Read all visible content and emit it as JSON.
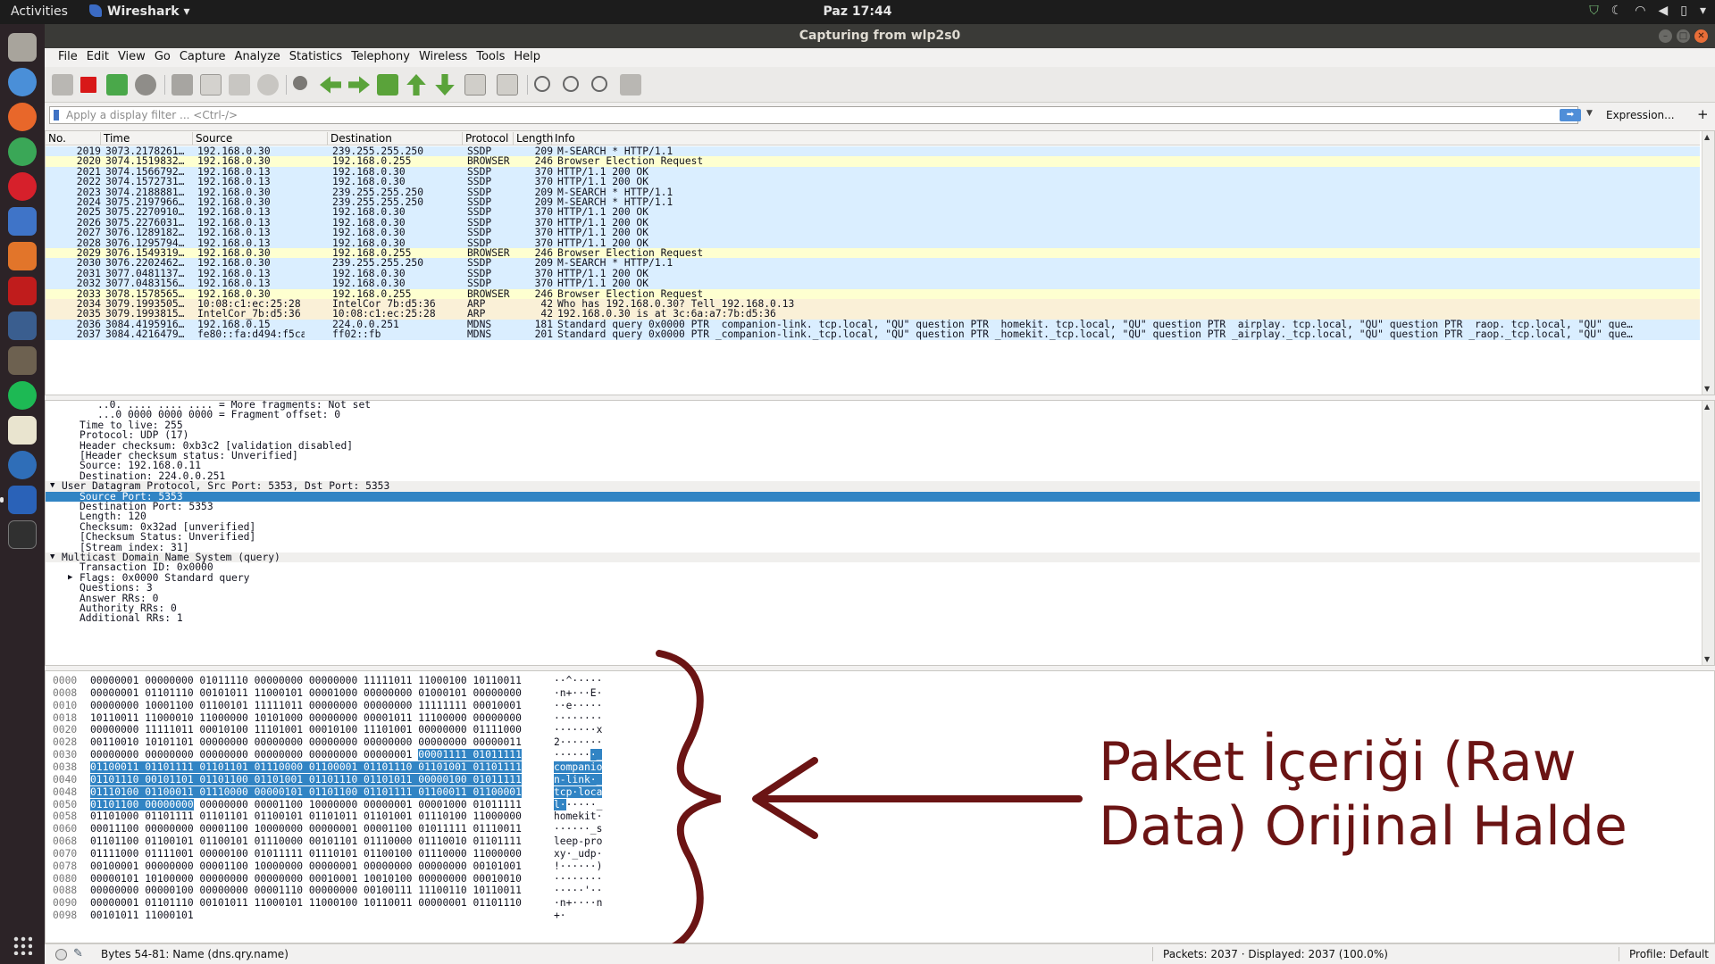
{
  "topbar": {
    "activities": "Activities",
    "app_name": "Wireshark",
    "clock": "Paz 17:44"
  },
  "window": {
    "title": "Capturing from wlp2s0"
  },
  "menu": [
    "File",
    "Edit",
    "View",
    "Go",
    "Capture",
    "Analyze",
    "Statistics",
    "Telephony",
    "Wireless",
    "Tools",
    "Help"
  ],
  "filter": {
    "placeholder": "Apply a display filter ... <Ctrl-/>",
    "expression_label": "Expression...",
    "add_label": "+"
  },
  "packet_list": {
    "columns": [
      "No.",
      "Time",
      "Source",
      "Destination",
      "Protocol",
      "Length",
      "Info"
    ],
    "colors": {
      "udp": "#daeeff",
      "smb": "#feffd0",
      "arp": "#faf0d7"
    },
    "rows": [
      {
        "no": "2019",
        "time": "3073.2178261…",
        "src": "192.168.0.30",
        "dst": "239.255.255.250",
        "proto": "SSDP",
        "len": "209",
        "info": "M-SEARCH * HTTP/1.1",
        "kind": "udp"
      },
      {
        "no": "2020",
        "time": "3074.1519832…",
        "src": "192.168.0.30",
        "dst": "192.168.0.255",
        "proto": "BROWSER",
        "len": "246",
        "info": "Browser Election Request",
        "kind": "smb"
      },
      {
        "no": "2021",
        "time": "3074.1566792…",
        "src": "192.168.0.13",
        "dst": "192.168.0.30",
        "proto": "SSDP",
        "len": "370",
        "info": "HTTP/1.1 200 OK",
        "kind": "udp"
      },
      {
        "no": "2022",
        "time": "3074.1572731…",
        "src": "192.168.0.13",
        "dst": "192.168.0.30",
        "proto": "SSDP",
        "len": "370",
        "info": "HTTP/1.1 200 OK",
        "kind": "udp"
      },
      {
        "no": "2023",
        "time": "3074.2188881…",
        "src": "192.168.0.30",
        "dst": "239.255.255.250",
        "proto": "SSDP",
        "len": "209",
        "info": "M-SEARCH * HTTP/1.1",
        "kind": "udp"
      },
      {
        "no": "2024",
        "time": "3075.2197966…",
        "src": "192.168.0.30",
        "dst": "239.255.255.250",
        "proto": "SSDP",
        "len": "209",
        "info": "M-SEARCH * HTTP/1.1",
        "kind": "udp"
      },
      {
        "no": "2025",
        "time": "3075.2270910…",
        "src": "192.168.0.13",
        "dst": "192.168.0.30",
        "proto": "SSDP",
        "len": "370",
        "info": "HTTP/1.1 200 OK",
        "kind": "udp"
      },
      {
        "no": "2026",
        "time": "3075.2276031…",
        "src": "192.168.0.13",
        "dst": "192.168.0.30",
        "proto": "SSDP",
        "len": "370",
        "info": "HTTP/1.1 200 OK",
        "kind": "udp"
      },
      {
        "no": "2027",
        "time": "3076.1289182…",
        "src": "192.168.0.13",
        "dst": "192.168.0.30",
        "proto": "SSDP",
        "len": "370",
        "info": "HTTP/1.1 200 OK",
        "kind": "udp"
      },
      {
        "no": "2028",
        "time": "3076.1295794…",
        "src": "192.168.0.13",
        "dst": "192.168.0.30",
        "proto": "SSDP",
        "len": "370",
        "info": "HTTP/1.1 200 OK",
        "kind": "udp"
      },
      {
        "no": "2029",
        "time": "3076.1549319…",
        "src": "192.168.0.30",
        "dst": "192.168.0.255",
        "proto": "BROWSER",
        "len": "246",
        "info": "Browser Election Request",
        "kind": "smb"
      },
      {
        "no": "2030",
        "time": "3076.2202462…",
        "src": "192.168.0.30",
        "dst": "239.255.255.250",
        "proto": "SSDP",
        "len": "209",
        "info": "M-SEARCH * HTTP/1.1",
        "kind": "udp"
      },
      {
        "no": "2031",
        "time": "3077.0481137…",
        "src": "192.168.0.13",
        "dst": "192.168.0.30",
        "proto": "SSDP",
        "len": "370",
        "info": "HTTP/1.1 200 OK",
        "kind": "udp"
      },
      {
        "no": "2032",
        "time": "3077.0483156…",
        "src": "192.168.0.13",
        "dst": "192.168.0.30",
        "proto": "SSDP",
        "len": "370",
        "info": "HTTP/1.1 200 OK",
        "kind": "udp"
      },
      {
        "no": "2033",
        "time": "3078.1578565…",
        "src": "192.168.0.30",
        "dst": "192.168.0.255",
        "proto": "BROWSER",
        "len": "246",
        "info": "Browser Election Request",
        "kind": "smb"
      },
      {
        "no": "2034",
        "time": "3079.1993505…",
        "src": "10:08:c1:ec:25:28",
        "dst": "IntelCor_7b:d5:36",
        "proto": "ARP",
        "len": "42",
        "info": "Who has 192.168.0.30? Tell 192.168.0.13",
        "kind": "arp"
      },
      {
        "no": "2035",
        "time": "3079.1993815…",
        "src": "IntelCor_7b:d5:36",
        "dst": "10:08:c1:ec:25:28",
        "proto": "ARP",
        "len": "42",
        "info": "192.168.0.30 is at 3c:6a:a7:7b:d5:36",
        "kind": "arp"
      },
      {
        "no": "2036",
        "time": "3084.4195916…",
        "src": "192.168.0.15",
        "dst": "224.0.0.251",
        "proto": "MDNS",
        "len": "181",
        "info": "Standard query 0x0000 PTR _companion-link._tcp.local, \"QU\" question PTR _homekit._tcp.local, \"QU\" question PTR _airplay._tcp.local, \"QU\" question PTR _raop._tcp.local, \"QU\" que…",
        "kind": "udp"
      },
      {
        "no": "2037",
        "time": "3084.4216479…",
        "src": "fe80::fa:d494:f5ca:…",
        "dst": "ff02::fb",
        "proto": "MDNS",
        "len": "201",
        "info": "Standard query 0x0000 PTR _companion-link._tcp.local, \"QU\" question PTR _homekit._tcp.local, \"QU\" question PTR _airplay._tcp.local, \"QU\" question PTR _raop._tcp.local, \"QU\" que…",
        "kind": "udp"
      }
    ]
  },
  "details": [
    {
      "text": "..0. .... .... .... = More fragments: Not set",
      "indent": 2
    },
    {
      "text": "...0 0000 0000 0000 = Fragment offset: 0",
      "indent": 2
    },
    {
      "text": "Time to live: 255",
      "indent": 1
    },
    {
      "text": "Protocol: UDP (17)",
      "indent": 1
    },
    {
      "text": "Header checksum: 0xb3c2 [validation disabled]",
      "indent": 1
    },
    {
      "text": "[Header checksum status: Unverified]",
      "indent": 1
    },
    {
      "text": "Source: 192.168.0.11",
      "indent": 1
    },
    {
      "text": "Destination: 224.0.0.251",
      "indent": 1
    },
    {
      "text": "User Datagram Protocol, Src Port: 5353, Dst Port: 5353",
      "indent": 0,
      "expander": "open",
      "header": true
    },
    {
      "text": "Source Port: 5353",
      "indent": 1,
      "selected": true
    },
    {
      "text": "Destination Port: 5353",
      "indent": 1
    },
    {
      "text": "Length: 120",
      "indent": 1
    },
    {
      "text": "Checksum: 0x32ad [unverified]",
      "indent": 1
    },
    {
      "text": "[Checksum Status: Unverified]",
      "indent": 1
    },
    {
      "text": "[Stream index: 31]",
      "indent": 1
    },
    {
      "text": "Multicast Domain Name System (query)",
      "indent": 0,
      "expander": "open",
      "header": true
    },
    {
      "text": "Transaction ID: 0x0000",
      "indent": 1
    },
    {
      "text": "Flags: 0x0000 Standard query",
      "indent": 1,
      "expander": "closed"
    },
    {
      "text": "Questions: 3",
      "indent": 1
    },
    {
      "text": "Answer RRs: 0",
      "indent": 1
    },
    {
      "text": "Authority RRs: 0",
      "indent": 1
    },
    {
      "text": "Additional RRs: 1",
      "indent": 1
    }
  ],
  "bytes": [
    {
      "off": "0000",
      "pre": "00000001 00000000 01011110 00000000 00000000 11111011 11000100 10110011",
      "hl": "",
      "post": "",
      "apre": "··^·····",
      "ahl": "",
      "apost": ""
    },
    {
      "off": "0008",
      "pre": "00000001 01101110 00101011 11000101 00001000 00000000 01000101 00000000",
      "hl": "",
      "post": "",
      "apre": "·n+···E·",
      "ahl": "",
      "apost": ""
    },
    {
      "off": "0010",
      "pre": "00000000 10001100 01100101 11111011 00000000 00000000 11111111 00010001",
      "hl": "",
      "post": "",
      "apre": "··e·····",
      "ahl": "",
      "apost": ""
    },
    {
      "off": "0018",
      "pre": "10110011 11000010 11000000 10101000 00000000 00001011 11100000 00000000",
      "hl": "",
      "post": "",
      "apre": "········",
      "ahl": "",
      "apost": ""
    },
    {
      "off": "0020",
      "pre": "00000000 11111011 00010100 11101001 00010100 11101001 00000000 01111000",
      "hl": "",
      "post": "",
      "apre": "·······x",
      "ahl": "",
      "apost": ""
    },
    {
      "off": "0028",
      "pre": "00110010 10101101 00000000 00000000 00000000 00000000 00000000 00000011",
      "hl": "",
      "post": "",
      "apre": "2·······",
      "ahl": "",
      "apost": ""
    },
    {
      "off": "0030",
      "pre": "00000000 00000000 00000000 00000000 00000000 00000001 ",
      "hl": "00001111 01011111",
      "post": "",
      "apre": "······",
      "ahl": "·_",
      "apost": ""
    },
    {
      "off": "0038",
      "pre": "",
      "hl": "01100011 01101111 01101101 01110000 01100001 01101110 01101001 01101111",
      "post": "",
      "apre": "",
      "ahl": "companio",
      "apost": ""
    },
    {
      "off": "0040",
      "pre": "",
      "hl": "01101110 00101101 01101100 01101001 01101110 01101011 00000100 01011111",
      "post": "",
      "apre": "",
      "ahl": "n-link·_",
      "apost": ""
    },
    {
      "off": "0048",
      "pre": "",
      "hl": "01110100 01100011 01110000 00000101 01101100 01101111 01100011 01100001",
      "post": "",
      "apre": "",
      "ahl": "tcp·loca",
      "apost": ""
    },
    {
      "off": "0050",
      "pre": "",
      "hl": "01101100 00000000",
      "post": " 00000000 00001100 10000000 00000001 00001000 01011111",
      "apre": "",
      "ahl": "l·",
      "apost": "·····_"
    },
    {
      "off": "0058",
      "pre": "01101000 01101111 01101101 01100101 01101011 01101001 01110100 11000000",
      "hl": "",
      "post": "",
      "apre": "homekit·",
      "ahl": "",
      "apost": ""
    },
    {
      "off": "0060",
      "pre": "00011100 00000000 00001100 10000000 00000001 00001100 01011111 01110011",
      "hl": "",
      "post": "",
      "apre": "······_s",
      "ahl": "",
      "apost": ""
    },
    {
      "off": "0068",
      "pre": "01101100 01100101 01100101 01110000 00101101 01110000 01110010 01101111",
      "hl": "",
      "post": "",
      "apre": "leep-pro",
      "ahl": "",
      "apost": ""
    },
    {
      "off": "0070",
      "pre": "01111000 01111001 00000100 01011111 01110101 01100100 01110000 11000000",
      "hl": "",
      "post": "",
      "apre": "xy·_udp·",
      "ahl": "",
      "apost": ""
    },
    {
      "off": "0078",
      "pre": "00100001 00000000 00001100 10000000 00000001 00000000 00000000 00101001",
      "hl": "",
      "post": "",
      "apre": "!······)",
      "ahl": "",
      "apost": ""
    },
    {
      "off": "0080",
      "pre": "00000101 10100000 00000000 00000000 00010001 10010100 00000000 00010010",
      "hl": "",
      "post": "",
      "apre": "········",
      "ahl": "",
      "apost": ""
    },
    {
      "off": "0088",
      "pre": "00000000 00000100 00000000 00001110 00000000 00100111 11100110 10110011",
      "hl": "",
      "post": "",
      "apre": "·····'··",
      "ahl": "",
      "apost": ""
    },
    {
      "off": "0090",
      "pre": "00000001 01101110 00101011 11000101 11000100 10110011 00000001 01101110",
      "hl": "",
      "post": "",
      "apre": "·n+····n",
      "ahl": "",
      "apost": ""
    },
    {
      "off": "0098",
      "pre": "00101011 11000101",
      "hl": "",
      "post": "",
      "apre": "+·",
      "ahl": "",
      "apost": ""
    }
  ],
  "annotation": {
    "line1": "Paket İçeriği (Raw",
    "line2": "Data) Orijinal Halde",
    "color": "#6b1414"
  },
  "status": {
    "left": "Bytes 54-81: Name (dns.qry.name)",
    "middle": "Packets: 2037 · Displayed: 2037 (100.0%)",
    "right": "Profile: Default"
  }
}
